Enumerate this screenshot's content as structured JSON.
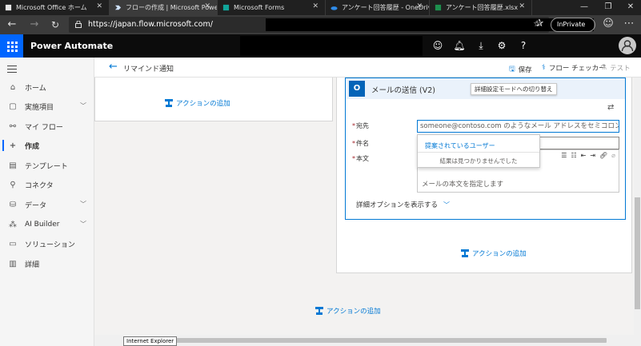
{
  "browser": {
    "tabs": [
      {
        "title": "Microsoft Office ホーム"
      },
      {
        "title": "フローの作成 | Microsoft Power"
      },
      {
        "title": "Microsoft Forms"
      },
      {
        "title": "アンケート回答履歴 - OneDrive"
      },
      {
        "title": "アンケート回答履歴.xlsx"
      }
    ],
    "url": "https://japan.flow.microsoft.com/",
    "inprivate": "InPrivate"
  },
  "app": {
    "name": "Power Automate"
  },
  "nav": {
    "items": [
      {
        "label": "ホーム"
      },
      {
        "label": "実施項目"
      },
      {
        "label": "マイ フロー"
      },
      {
        "label": "作成"
      },
      {
        "label": "テンプレート"
      },
      {
        "label": "コネクタ"
      },
      {
        "label": "データ"
      },
      {
        "label": "AI Builder"
      },
      {
        "label": "ソリューション"
      },
      {
        "label": "詳細"
      }
    ]
  },
  "cmdbar": {
    "flow_title": "リマインド通知",
    "save": "保存",
    "checker": "フロー チェッカー",
    "test": "テスト"
  },
  "canvas": {
    "add_action": "アクションの追加"
  },
  "email": {
    "title": "メールの送信 (V2)",
    "tooltip": "詳細設定モードへの切り替え",
    "to_label": "宛先",
    "to_placeholder": "someone@contoso.com のようなメール アドレスをセミコロンで区切って指定",
    "subject_label": "件名",
    "body_label": "本文",
    "body_placeholder": "メールの本文を指定します",
    "suggest_title": "提案されているユーザー",
    "suggest_none": "結果は見つかりませんでした",
    "advanced": "詳細オプションを表示する"
  },
  "statusbar": {
    "ie_tip": "Internet Explorer"
  },
  "colors": {
    "accent": "#0078d4",
    "waffle": "#0066ff"
  }
}
